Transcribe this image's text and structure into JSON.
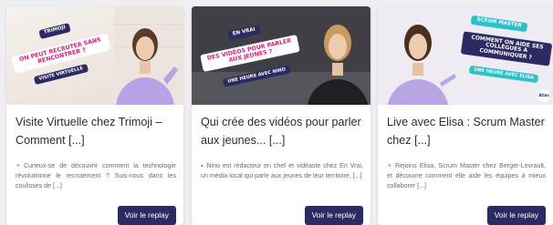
{
  "cards": [
    {
      "thumb": {
        "tag_top": "TRIMOJI",
        "headline": "ON PEUT RECRUTER SANS RENCONTRER ?",
        "tag_bottom": "VISITE VIRTUELLE"
      },
      "title": "Visite Virtuelle chez Trimoji – Comment [...]",
      "icon": "sparkle-icon",
      "description": "Curieux·se de découvrir comment la technologie révolutionne le recrutement ? Suis-nous dans les coulisses de [...]",
      "button": "Voir le replay"
    },
    {
      "thumb": {
        "tag_top": "EN VRAI",
        "headline": "DES VIDÉOS POUR PARLER AUX JEUNES ?",
        "tag_bottom": "UNE HEURE AVEC NINO"
      },
      "title": "Qui crée des vidéos pour parler aux jeunes... [...]",
      "icon": "video-camera-icon",
      "description": "Nino est rédacteur en chef et vidéaste chez En Vrai, un média local qui parle aux jeunes de leur territoire, [...]",
      "button": "Voir le replay"
    },
    {
      "thumb": {
        "tag_top": "SCRUM MASTER",
        "headline": "COMMENT ON AIDE SES COLLÈGUES À COMMUNIQUER ?",
        "tag_bottom": "UNE HEURE AVEC ELISA",
        "logo": "Atlas"
      },
      "title": "Live avec Elisa : Scrum Master chez [...]",
      "icon": "sparkle-icon",
      "description": "Rejoins Elisa, Scrum Master chez Berger-Levrault, et découvre comment elle aide les équipes à mieux collaborer [...]",
      "button": "Voir le replay"
    }
  ]
}
